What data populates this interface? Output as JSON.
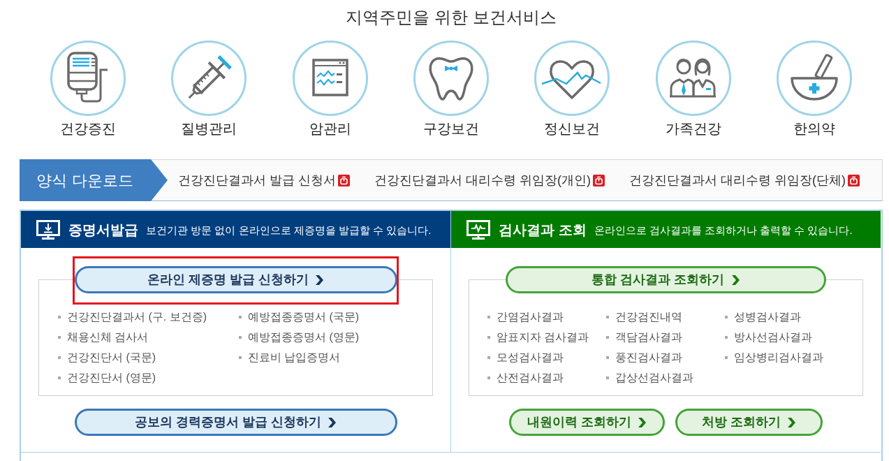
{
  "page_title": "지역주민을 위한 보건서비스",
  "services": [
    "건강증진",
    "질병관리",
    "암관리",
    "구강보건",
    "정신보건",
    "가족건강",
    "한의약"
  ],
  "form_download": {
    "label": "양식 다운로드",
    "files": [
      "건강진단결과서 발급 신청서",
      "건강진단결과서 대리수령 위임장(개인)",
      "건강진단결과서 대리수령 위임장(단체)"
    ]
  },
  "panels": [
    {
      "kind": "certificate",
      "title": "증명서발급",
      "description": "보건기관 방문 없이 온라인으로 제증명을 발급할 수 있습니다.",
      "main_button": {
        "label": "온라인 제증명 발급 신청하기",
        "highlighted": true
      },
      "columns": [
        [
          "건강진단결과서 (구. 보건증)",
          "채용신체 검사서",
          "건강진단서 (국문)",
          "건강진단서 (영문)"
        ],
        [
          "예방접종증명서 (국문)",
          "예방접종증명서 (영문)",
          "진료비 납입증명서"
        ]
      ],
      "buttons": [
        {
          "label": "공보의 경력증명서 발급 신청하기",
          "highlighted": false
        }
      ]
    },
    {
      "kind": "results",
      "title": "검사결과 조회",
      "description": "온라인으로 검사결과를 조회하거나 출력할 수 있습니다.",
      "main_button": {
        "label": "통합 검사결과 조회하기",
        "highlighted": false
      },
      "columns": [
        [
          "간염검사결과",
          "암표지자 검사결과",
          "모성검사결과",
          "산전검사결과"
        ],
        [
          "건강검진내역",
          "객담검사결과",
          "풍진검사결과",
          "갑상선검사결과"
        ],
        [
          "성병검사결과",
          "방사선검사결과",
          "임상병리검사결과"
        ]
      ],
      "buttons": [
        {
          "label": "내원이력 조회하기",
          "highlighted": false
        },
        {
          "label": "처방 조회하기",
          "highlighted": false
        }
      ]
    }
  ]
}
